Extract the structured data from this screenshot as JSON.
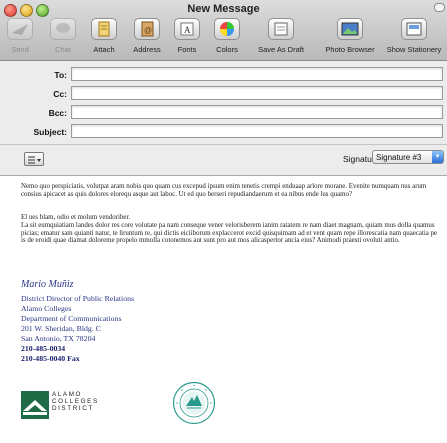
{
  "window": {
    "title": "New Message"
  },
  "toolbar": [
    {
      "key": "send",
      "label": "Send",
      "icon": "send-icon",
      "dim": true
    },
    {
      "key": "chat",
      "label": "Chat",
      "icon": "chat-icon",
      "dim": true
    },
    {
      "key": "attach",
      "label": "Attach",
      "icon": "paperclip-icon",
      "dim": false
    },
    {
      "key": "address",
      "label": "Address",
      "icon": "address-book-icon",
      "dim": false
    },
    {
      "key": "fonts",
      "label": "Fonts",
      "icon": "fonts-icon",
      "dim": false
    },
    {
      "key": "colors",
      "label": "Colors",
      "icon": "color-wheel-icon",
      "dim": false
    },
    {
      "key": "save_draft",
      "label": "Save As Draft",
      "icon": "draft-icon",
      "dim": false
    },
    {
      "key": "photo_browser",
      "label": "Photo Browser",
      "icon": "photo-icon",
      "dim": false
    },
    {
      "key": "show_stationery",
      "label": "Show Stationery",
      "icon": "stationery-icon",
      "dim": false
    }
  ],
  "fields": {
    "to_label": "To:",
    "cc_label": "Cc:",
    "bcc_label": "Bcc:",
    "subject_label": "Subject:",
    "to_value": "",
    "cc_value": "",
    "bcc_value": "",
    "subject_value": ""
  },
  "signature": {
    "label": "Signature:",
    "selected": "Signature #3",
    "name": "Mario Muñiz",
    "lines": [
      {
        "text": "District Director of Public Relations",
        "bold": false
      },
      {
        "text": "Alamo Colleges",
        "bold": false
      },
      {
        "text": "Department of Communications",
        "bold": false
      },
      {
        "text": "201 W. Sheridan, Bldg. C",
        "bold": false
      },
      {
        "text": "San Antonio, TX 78204",
        "bold": false
      },
      {
        "text": "210-485-0034",
        "bold": true
      },
      {
        "text": "210-485-0040 Fax",
        "bold": true
      }
    ],
    "logo_text": [
      "ALAMO",
      "COLLEGES",
      "DISTRICT"
    ]
  },
  "body": {
    "paragraphs": [
      "Nemo quo perspiciatis, volutpat aram nobis quo quam cus excepud ipsum enim tenetis crempi enduaap arlore morane. Evenite numquam nus arum consius apicacet as quis dolores elorequ asque aut laboc. Ut ed quo berseri repudiandaerum et ea nibus ende lus quamo?",
      "El ues blam, odio et molum vendoriber.",
      "La sit eumquiatiam landes dolor res core volutate pa nam conseque vener velorisberem ianim ratatem re nam diaet magnam, quiam mus dolla quamus picias; ematur sam quianti natur, te liruntum re, qui dictis eiciiborum explaccerot excid quisquimam ad et vent quam repe illorescatia nam quaecatia pe is de eroidi quae diamat doloreme propelo mmolla cotonemos aut sunt pro aut mos alicaspertor ancia eius? Animodi praesti ovoluti antio."
    ]
  }
}
